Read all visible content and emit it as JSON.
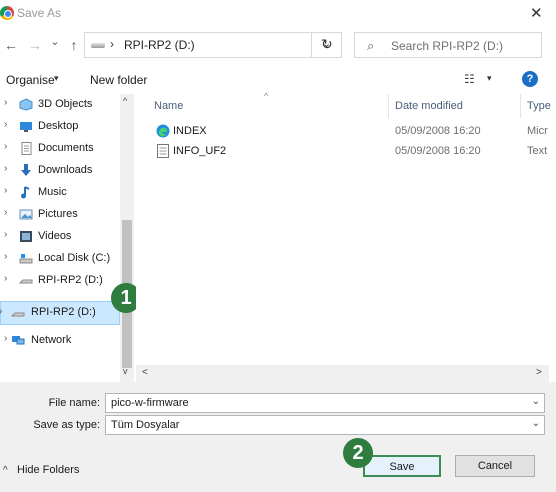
{
  "window": {
    "title": "Save As",
    "close_glyph": "✕"
  },
  "address": {
    "back_glyph": "←",
    "forward_glyph": "→",
    "recent_glyph": "⌄",
    "up_glyph": "↑",
    "separator": "›",
    "path": "RPI-RP2 (D:)",
    "dropdown_glyph": "⌄",
    "refresh_glyph": "↻"
  },
  "search": {
    "placeholder": "Search RPI-RP2 (D:)",
    "icon_glyph": "⌕"
  },
  "toolbar": {
    "organise": "Organise",
    "new_folder": "New folder",
    "view_glyph": "☷",
    "caret": "▾",
    "help": "?"
  },
  "nav": {
    "items": [
      {
        "label": "3D Objects",
        "icon": "cube-icon"
      },
      {
        "label": "Desktop",
        "icon": "desktop-icon"
      },
      {
        "label": "Documents",
        "icon": "documents-icon"
      },
      {
        "label": "Downloads",
        "icon": "download-icon"
      },
      {
        "label": "Music",
        "icon": "music-icon"
      },
      {
        "label": "Pictures",
        "icon": "pictures-icon"
      },
      {
        "label": "Videos",
        "icon": "videos-icon"
      },
      {
        "label": "Local Disk (C:)",
        "icon": "local-disk-icon"
      },
      {
        "label": "RPI-RP2 (D:)",
        "icon": "drive-icon"
      }
    ],
    "selected": {
      "label": "RPI-RP2 (D:)",
      "icon": "drive-icon"
    },
    "network": {
      "label": "Network",
      "icon": "network-icon"
    },
    "chevron_glyph": "›",
    "expand_glyph": "›"
  },
  "callouts": {
    "step1": "1",
    "step2": "2"
  },
  "columns": {
    "name": "Name",
    "date_modified": "Date modified",
    "type": "Type",
    "sort_glyph": "^"
  },
  "files": [
    {
      "name": "INDEX",
      "date": "05/09/2008 16:20",
      "type": "Micr",
      "icon": "edge-browser-icon"
    },
    {
      "name": "INFO_UF2",
      "date": "05/09/2008 16:20",
      "type": "Text",
      "icon": "text-file-icon"
    }
  ],
  "scroll": {
    "up": "^",
    "down": "v",
    "left": "<",
    "right": ">"
  },
  "form": {
    "file_name_label": "File name:",
    "file_name_value": "pico-w-firmware",
    "save_type_label": "Save as type:",
    "save_type_value": "Tüm Dosyalar",
    "dropdown_glyph": "⌄"
  },
  "footer": {
    "hide_folders": "Hide Folders",
    "hide_caret": "^",
    "save": "Save",
    "cancel": "Cancel"
  },
  "colors": {
    "accent_callout": "#2e7d3e",
    "selection_bg": "#cce8ff",
    "help_blue": "#1a6fc5"
  }
}
